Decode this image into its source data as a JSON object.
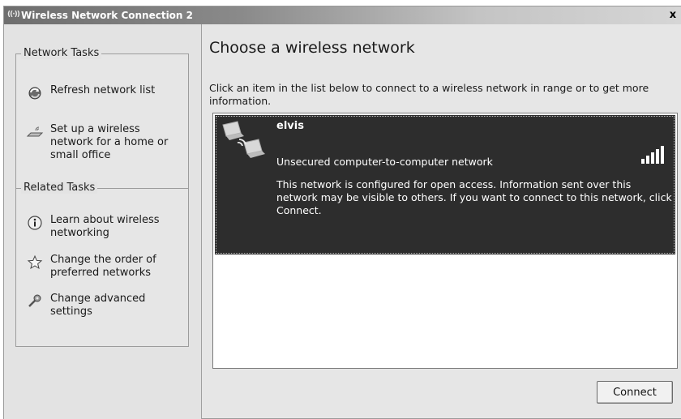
{
  "window": {
    "title": "Wireless Network Connection 2",
    "close_glyph": "x",
    "title_icon": "wireless-signal-icon"
  },
  "sidebar": {
    "network_tasks": {
      "title": "Network Tasks",
      "items": [
        {
          "label": "Refresh network list",
          "icon": "refresh-icon"
        },
        {
          "label": "Set up a wireless network for a home or small office",
          "icon": "wireless-setup-icon"
        }
      ]
    },
    "related_tasks": {
      "title": "Related Tasks",
      "items": [
        {
          "label": "Learn about wireless networking",
          "icon": "info-icon"
        },
        {
          "label": "Change the order of preferred networks",
          "icon": "star-icon"
        },
        {
          "label": "Change advanced settings",
          "icon": "settings-icon"
        }
      ]
    }
  },
  "main": {
    "heading": "Choose a wireless network",
    "description": "Click an item in the list below to connect to a wireless network in range or to get more information.",
    "networks": [
      {
        "name": "elvis",
        "security": "Unsecured computer-to-computer network",
        "info": "This network is configured for open access. Information sent over this network may be visible to others. If you want to connect to this network, click Connect.",
        "icon": "computer-to-computer-icon",
        "signal_icon": "signal-strength-icon"
      }
    ],
    "connect_label": "Connect"
  },
  "colors": {
    "selected_item_bg": "#2d2d2d",
    "panel_bg": "#e6e6e6"
  }
}
